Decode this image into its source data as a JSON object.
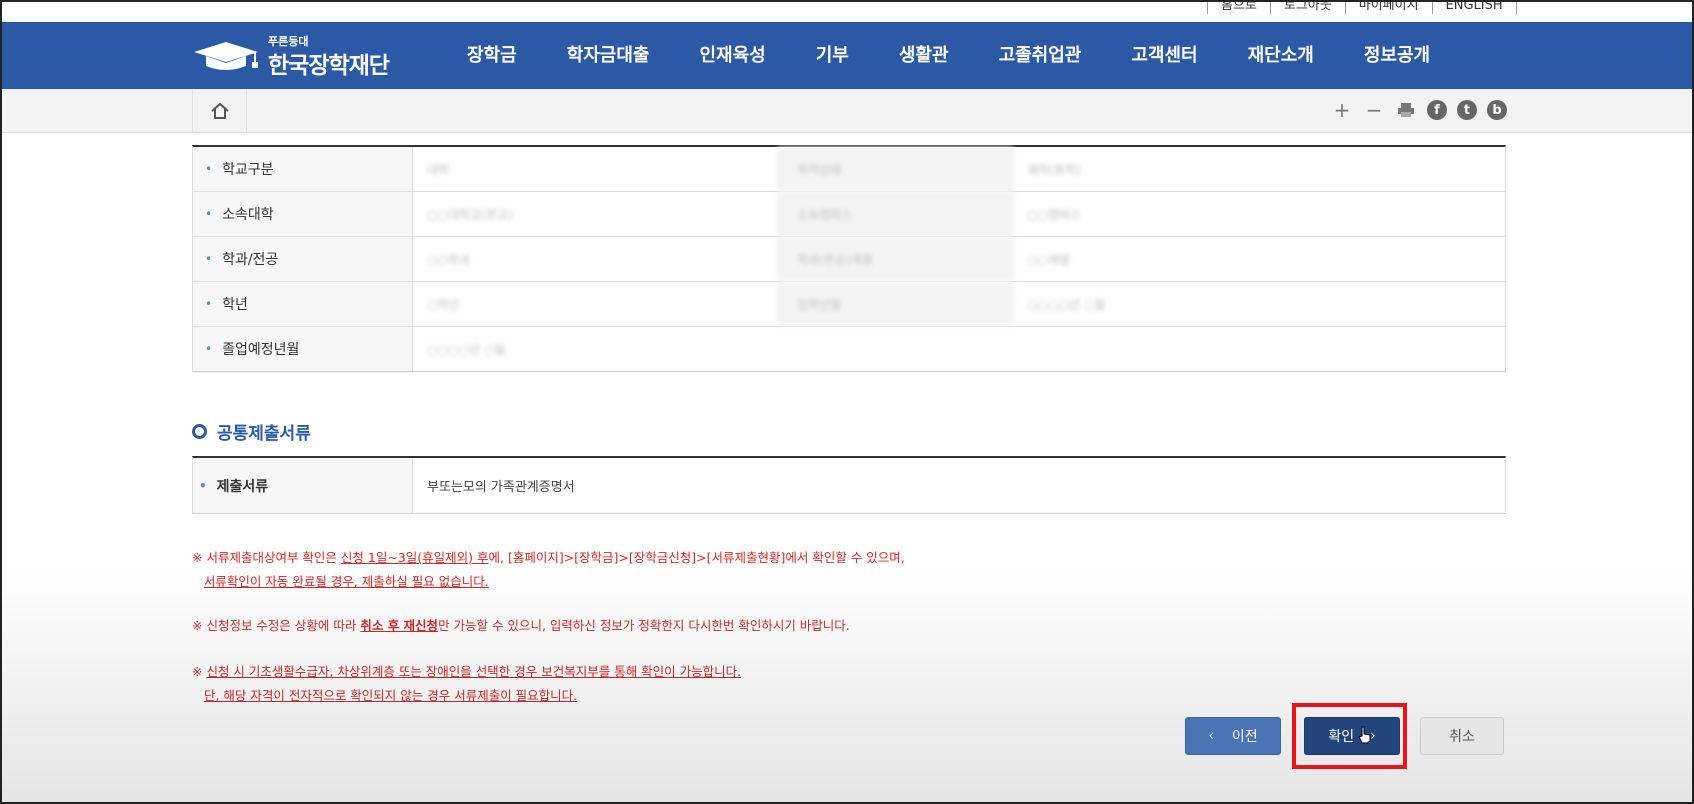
{
  "util_links": [
    "홈으로",
    "로그아웃",
    "마이페이지",
    "ENGLISH"
  ],
  "logo": {
    "sub": "푸른등대",
    "name": "한국장학재단"
  },
  "nav": [
    "장학금",
    "학자금대출",
    "인재육성",
    "기부",
    "생활관",
    "고졸취업관",
    "고객센터",
    "재단소개",
    "정보공개"
  ],
  "tools": {
    "zoom_in": "+",
    "zoom_out": "−",
    "facebook": "f",
    "twitter": "t",
    "blog": "b"
  },
  "info_table": {
    "rows": [
      {
        "label": "학교구분",
        "value": "대학",
        "label2": "학적상태",
        "value2": "재학(휴학)"
      },
      {
        "label": "소속대학",
        "value": "○○대학교(본교)",
        "label2": "소속캠퍼스",
        "value2": "○○캠퍼스"
      },
      {
        "label": "학과/전공",
        "value": "○○학과",
        "label2": "학과(전공)계열",
        "value2": "○○계열"
      },
      {
        "label": "학년",
        "value": "○학년",
        "label2": "입학년월",
        "value2": "○○○○년 ○월"
      },
      {
        "label": "졸업예정년월",
        "value": "○○○○년 ○월"
      }
    ]
  },
  "section_title": "공통제출서류",
  "documents": {
    "label": "제출서류",
    "value": "부또는모의 가족관계증명서"
  },
  "notices": {
    "n1_a": "※ 서류제출대상여부 확인은 ",
    "n1_b": "신청 1일~3일(휴일제외) 후",
    "n1_c": "에, [홈페이지]>[장학금]>[장학금신청]>[서류제출현황]에서 확인할 수 있으며,",
    "n1_d": "서류확인이 자동 완료될 경우, 제출하실 필요 없습니다.",
    "n2_a": "※ 신청정보 수정은 상황에 따라 ",
    "n2_b": "취소 후 재신청",
    "n2_c": "만 가능할 수 있으니, 입력하신 정보가 정확한지 다시한번 확인하시기 바랍니다.",
    "n3_a": "※ ",
    "n3_b": "신청 시 기초생활수급자, 차상위계층 또는 장애인을 선택한 경우 보건복지부를 통해 확인이 가능합니다.",
    "n3_c": "단, 해당 자격이 전자적으로 확인되지 않는 경우 서류제출이 필요합니다."
  },
  "buttons": {
    "prev": "이전",
    "ok": "확인",
    "cancel": "취소"
  },
  "colors": {
    "header": "#2c59a5",
    "notice": "#d02a2a",
    "highlight": "#e8141c",
    "ok_button": "#24457c"
  }
}
